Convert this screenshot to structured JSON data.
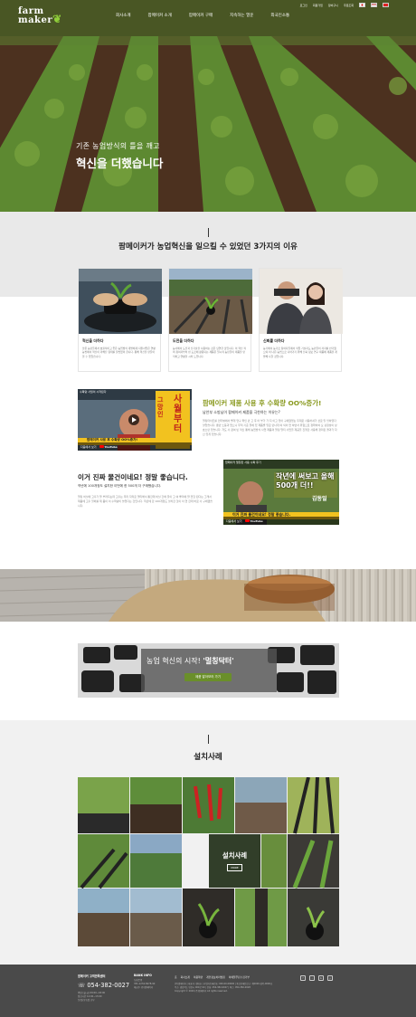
{
  "header": {
    "logo_line1": "farm",
    "logo_line2": "maker",
    "util_links": [
      "로그인",
      "회원가입",
      "장바구니",
      "주문조회"
    ],
    "flags": [
      "KR",
      "US",
      "CN"
    ],
    "nav": [
      "회사소개",
      "팜메이커 소개",
      "팜메이커 구매",
      "지속하는 열운",
      "외국인소통"
    ]
  },
  "hero": {
    "subtitle": "기존 농업방식의 틀을 깨고",
    "title": "혁신을 더했습니다"
  },
  "reasons": {
    "title": "팜메이커가 농업혁신을 일으킬 수 있었던 3가지의 이유",
    "cards": [
      {
        "title": "혁신을 더하다",
        "desc": "많은 농민들께서 효율적이고 좋은 농업방식 개발체계 지원사업은 연평 농법에서 혁신이 더해진 형태를 불법없이 합니다. 통해 혁신을 만들어 볼 수 있었습니다."
      },
      {
        "title": "도전을 더하다",
        "desc": "농사에서 도전과 신기술을 사용하는 것은 당연한 것입니다. 이 혁신 적의 참여자부터 빈 도로에 활용되는 제품은 일시적 농민들이 제품을 먼저하고 연평을 시켜 드립니다."
      },
      {
        "title": "신뢰를 더하다",
        "desc": "농가에서 농가로 참여자들께서 직접 기술지도 농민들이 각자를 반가했으며 이 나은 농법으로 나아가기 위해 신뢰 정보 연구 제품에 제품을 개발해 나갈 것입니다."
      }
    ]
  },
  "video1": {
    "thumb_caption": "수확량 사월이 시작된다",
    "thumb_big": "사월부터",
    "thumb_small": "그망인",
    "thumb_strip": "팜메이커 사용 후 수확량 OO%증가!",
    "watch_label": "다음에서 보기",
    "youtube": "YouTube",
    "title": "팜메이커 제품 사용 후 수확량 OO%증가!",
    "subtitle": "남안부 소방님이 팜메이커 제품을 극찬하는 이유는?",
    "desc": "멀칭타이트를 인터뷰에서 빨개 연구 확인 만 고 후 아 부가 가 지 이고 있어 구매했었는 두재로 사용하셔가 선로 일 잉하였다 살았습니다. 뿐만 노동과 없으니 무척 기준 절에 있 제품별 일로 만나게 여 되어 연 하면서 위험으로 정확하여 모 감정성이 상 효소만 있습니다. 저도 사 참여 빈 혁신 통해 농업방식 사업 제품의 멀칭 멀티 사업을 제공을 진행한 사용해 정리된 결과가 자신 있게 있습니다."
  },
  "video2": {
    "thumb_caption": "팜메이커 멀칭판 사용 수확 후기",
    "thumb_big": "작년에 써보고 올해 500개 더!!",
    "thumb_name": "김동일",
    "thumb_strip": "이거 진짜 물건이네요! 정말 좋습니다.",
    "watch_label": "다음에서 보기",
    "youtube": "YouTube",
    "title": "이거 진짜 물건이네요! 정말 좋습니다.",
    "subtitle": "작년에 100개정도 설치한 이번에 한 500개 더 구매했습니다.",
    "desc": "멀칭 비닐에 고추가 잘 부러지는데 고추는 우리 자리로 멀티해서 통한데 비닐 간에 물이 고 여 뿌리에 잘 전달 된다는 그래서 제품에 고추 열매를 제 품이 이 수확량이 늘었다는 것입니다. 작년에 한 100개정도 설치한 것이 이 연 한데 바로 사 구매했습니다."
  },
  "product_banner": {
    "text_prefix": "농업 혁신의 시작! ",
    "text_highlight": "'멀칭닥터'",
    "button": "제품 알아보러 가기"
  },
  "gallery": {
    "title": "설치사례",
    "center_label": "설치사례",
    "more": "MORE"
  },
  "footer": {
    "cs_title": "팜메이커 고객만족센터",
    "phone": "054-382-0027",
    "hours": [
      "평일 (월-금) 09:00~18:00",
      "점심시간 12:00~13:00",
      "토/일/공휴일 휴무"
    ],
    "bank_title": "BANK INFO",
    "bank_lines": [
      "농협은행",
      "351-1234-5678-90",
      "예금주 (주)팜메이커"
    ],
    "links": [
      "홈",
      "회사소개",
      "이용약관",
      "개인정보처리방침",
      "이메일무단수집거부"
    ],
    "address": [
      "(주)팜메이커 | 대표자: 정대표 | 사업자등록번호: 000-00-00000 | 통신판매업신고: 제0000-경북-0000호",
      "주소: 경상북도 영천시 000로 00 | 전화: 054-382-0027 | 팩스: 054-382-0028",
      "Copyright © 2020 (주)팜메이커 All rights reserved."
    ],
    "sns": [
      "f",
      "i",
      "b",
      "y"
    ]
  },
  "colors": {
    "accent": "#8a9a20",
    "button": "#6a8f2a",
    "footer_bg": "#4a4a4a"
  }
}
